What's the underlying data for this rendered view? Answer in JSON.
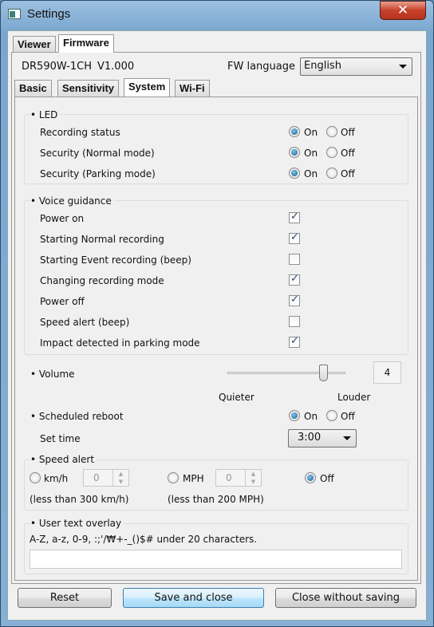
{
  "window": {
    "title": "Settings",
    "close_icon": "close-icon"
  },
  "top_tabs": [
    {
      "label": "Viewer",
      "selected": false
    },
    {
      "label": "Firmware",
      "selected": true
    }
  ],
  "firmware": {
    "model": "DR590W-1CH",
    "version": "V1.000",
    "fw_language_label": "FW language",
    "fw_language_value": "English"
  },
  "sub_tabs": [
    {
      "label": "Basic"
    },
    {
      "label": "Sensitivity"
    },
    {
      "label": "System",
      "selected": true
    },
    {
      "label": "Wi-Fi"
    }
  ],
  "led": {
    "title": "• LED",
    "on_label": "On",
    "off_label": "Off",
    "rows": [
      {
        "label": "Recording status",
        "value": "On"
      },
      {
        "label": "Security (Normal mode)",
        "value": "On"
      },
      {
        "label": "Security (Parking mode)",
        "value": "On"
      }
    ]
  },
  "voice": {
    "title": "• Voice guidance",
    "rows": [
      {
        "label": "Power on",
        "checked": true
      },
      {
        "label": "Starting Normal recording",
        "checked": true
      },
      {
        "label": "Starting Event recording (beep)",
        "checked": false
      },
      {
        "label": "Changing recording mode",
        "checked": true
      },
      {
        "label": "Power off",
        "checked": true
      },
      {
        "label": "Speed alert (beep)",
        "checked": false
      },
      {
        "label": "Impact detected in parking mode",
        "checked": true
      }
    ]
  },
  "volume": {
    "label": "• Volume",
    "value": "4",
    "quieter": "Quieter",
    "louder": "Louder"
  },
  "reboot": {
    "label": "• Scheduled reboot",
    "on_label": "On",
    "off_label": "Off",
    "value": "On",
    "set_time_label": "Set time",
    "set_time_value": "3:00"
  },
  "speed_alert": {
    "title": "• Speed alert",
    "kmh_label": "km/h",
    "kmh_value": "0",
    "kmh_note": "(less than 300 km/h)",
    "mph_label": "MPH",
    "mph_value": "0",
    "mph_note": "(less than 200 MPH)",
    "off_label": "Off",
    "selected": "Off"
  },
  "overlay": {
    "title": "• User text overlay",
    "hint": "A-Z, a-z, 0-9, :;'/₩+-_()$# under 20 characters.",
    "value": ""
  },
  "buttons": {
    "reset": "Reset",
    "save": "Save and close",
    "close": "Close without saving"
  }
}
